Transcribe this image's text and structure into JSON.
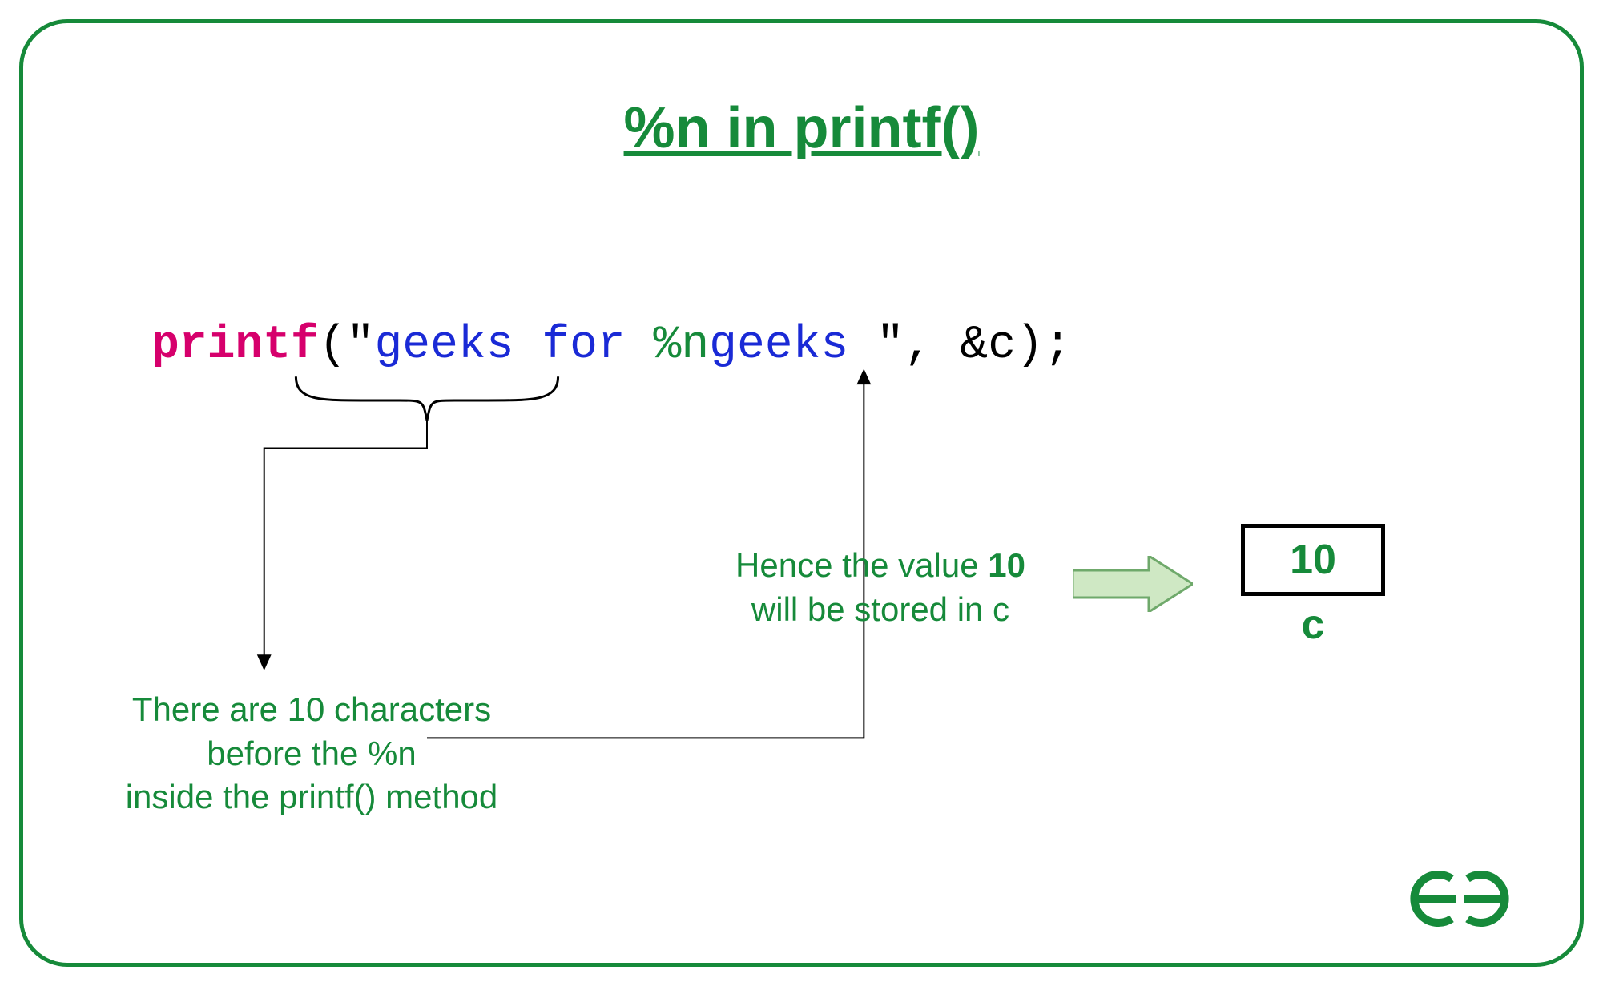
{
  "title": "%n in printf()",
  "code": {
    "keyword": "printf",
    "open": "(",
    "quote1": "\"",
    "str_before": "geeks for ",
    "spec": "%n",
    "str_after": "geeks ",
    "quote2": "\"",
    "mid": ", &c",
    "close": ")",
    "semi": ";"
  },
  "annotation1_line1": "There are 10 characters",
  "annotation1_line2": "before the %n",
  "annotation1_line3": "inside the printf() method",
  "annotation2_pre": "Hence the value ",
  "annotation2_val": "10",
  "annotation2_post": "will be stored in c",
  "box_value": "10",
  "box_label": "c",
  "colors": {
    "green": "#168a3a",
    "magenta": "#d6006c",
    "blue": "#1a2ad6",
    "arrow_fill": "#cfe8c4",
    "arrow_stroke": "#6fa96b"
  }
}
